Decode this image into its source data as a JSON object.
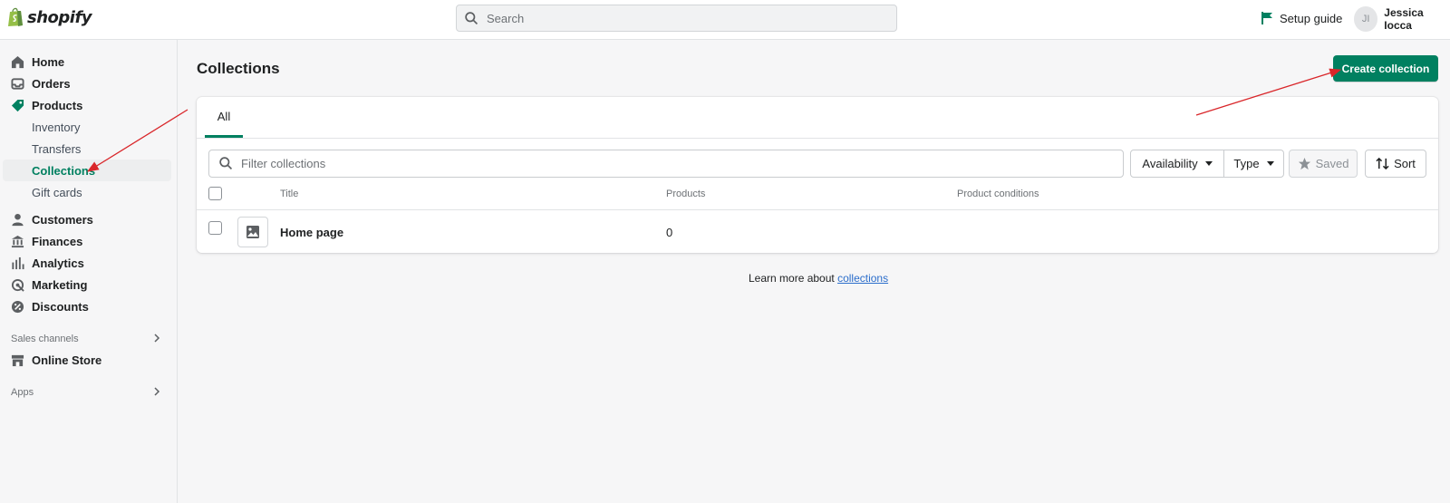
{
  "app": {
    "logo_text": "shopify"
  },
  "topbar": {
    "search_placeholder": "Search",
    "setup_guide": "Setup guide",
    "user_initials": "JI",
    "user_name": "Jessica Iocca"
  },
  "sidebar": {
    "items": [
      {
        "label": "Home",
        "icon": "home-icon"
      },
      {
        "label": "Orders",
        "icon": "orders-icon"
      },
      {
        "label": "Products",
        "icon": "tag-icon"
      }
    ],
    "product_sub": [
      {
        "label": "Inventory"
      },
      {
        "label": "Transfers"
      },
      {
        "label": "Collections"
      },
      {
        "label": "Gift cards"
      }
    ],
    "more_items": [
      {
        "label": "Customers",
        "icon": "person-icon"
      },
      {
        "label": "Finances",
        "icon": "bank-icon"
      },
      {
        "label": "Analytics",
        "icon": "bar-chart-icon"
      },
      {
        "label": "Marketing",
        "icon": "target-icon"
      },
      {
        "label": "Discounts",
        "icon": "discount-icon"
      }
    ],
    "sales_channels_label": "Sales channels",
    "online_store": "Online Store",
    "apps_label": "Apps"
  },
  "main": {
    "title": "Collections",
    "create_button": "Create collection",
    "tabs": [
      {
        "label": "All"
      }
    ],
    "filter_placeholder": "Filter collections",
    "filters": {
      "availability": "Availability",
      "type": "Type",
      "saved": "Saved",
      "sort": "Sort"
    },
    "table": {
      "columns": [
        "Title",
        "Products",
        "Product conditions"
      ],
      "rows": [
        {
          "title": "Home page",
          "products": "0",
          "conditions": ""
        }
      ]
    },
    "learn_more_prefix": "Learn more about ",
    "learn_more_link": "collections"
  },
  "colors": {
    "brand_green": "#008060",
    "arrow_red": "#d9262a",
    "link_blue": "#2c6ecb"
  }
}
